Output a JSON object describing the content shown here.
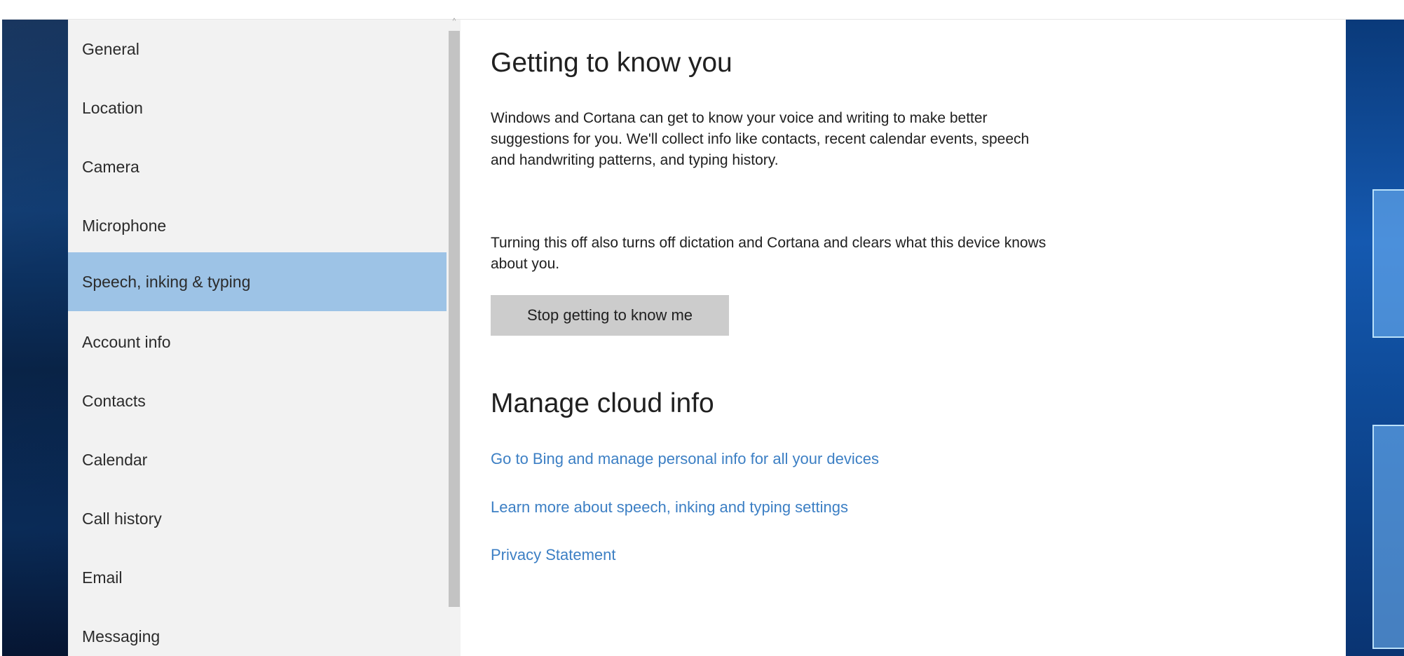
{
  "nav": {
    "items": [
      {
        "label": "General"
      },
      {
        "label": "Location"
      },
      {
        "label": "Camera"
      },
      {
        "label": "Microphone"
      },
      {
        "label": "Speech, inking & typing",
        "selected": true
      },
      {
        "label": "Account info"
      },
      {
        "label": "Contacts"
      },
      {
        "label": "Calendar"
      },
      {
        "label": "Call history"
      },
      {
        "label": "Email"
      },
      {
        "label": "Messaging"
      }
    ],
    "selected_color": "#9dc3e6"
  },
  "scrollbar": {
    "up_arrow": "^"
  },
  "section_know": {
    "title": "Getting to know you",
    "description": "Windows and Cortana can get to know your voice and writing to make better suggestions for you. We'll collect info like contacts, recent calendar events, speech and handwriting patterns, and typing history.",
    "warning": "Turning this off also turns off dictation and Cortana and clears what this device knows about you.",
    "button_label": "Stop getting to know me"
  },
  "section_cloud": {
    "title": "Manage cloud info",
    "links": [
      "Go to Bing and manage personal info for all your devices",
      "Learn more about speech, inking and typing settings",
      "Privacy Statement"
    ],
    "link_color": "#3c7fc4"
  }
}
